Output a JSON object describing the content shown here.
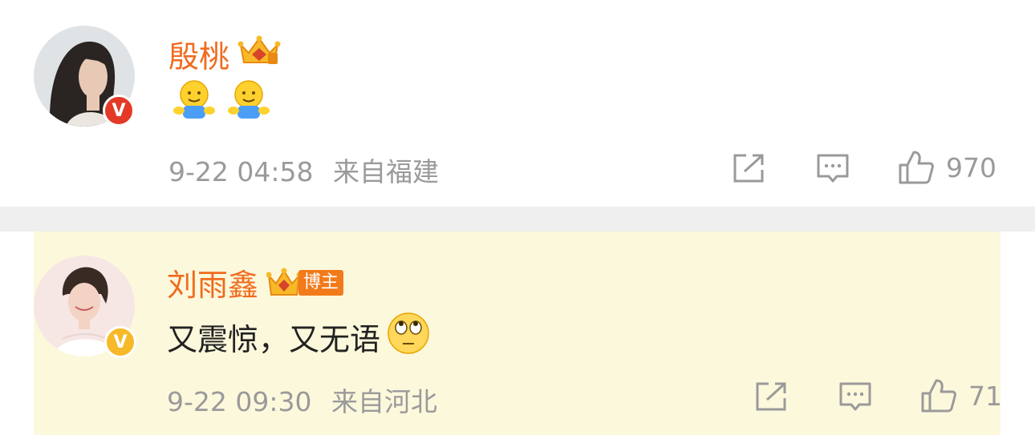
{
  "comments": [
    {
      "username": "殷桃",
      "content_text": "",
      "emoji": [
        "hug-emoji",
        "hug-emoji"
      ],
      "date": "9-22 04:58",
      "location": "来自福建",
      "likes": "970",
      "verified_color": "#e23a26"
    },
    {
      "username": "刘雨鑫",
      "badge_label": "博主",
      "content_text": "又震惊，又无语",
      "emoji": [
        "eye-roll-emoji"
      ],
      "date": "9-22 09:30",
      "location": "来自河北",
      "likes": "71",
      "verified_color": "#f7b928"
    }
  ],
  "colors": {
    "username": "#f06b1f",
    "meta": "#9a9a9a",
    "highlight_bg": "#fcf8dc",
    "separator": "#efefef"
  }
}
